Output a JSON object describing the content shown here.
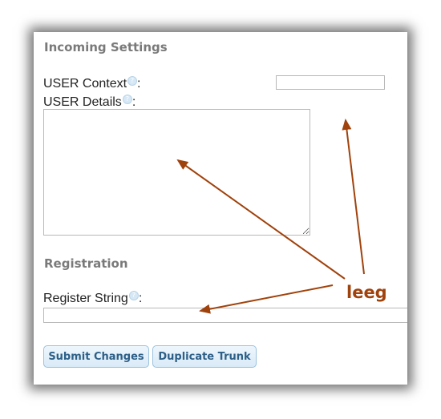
{
  "incoming": {
    "title": "Incoming Settings",
    "user_context_label": "USER Context",
    "user_context_value": "",
    "user_details_label": "USER Details",
    "user_details_value": ""
  },
  "registration": {
    "title": "Registration",
    "register_string_label": "Register String",
    "register_string_value": ""
  },
  "help_glyph": "?",
  "colon": ":",
  "buttons": {
    "submit": "Submit Changes",
    "duplicate": "Duplicate Trunk"
  },
  "annotation": {
    "text": "leeg",
    "color": "#a0420c"
  }
}
